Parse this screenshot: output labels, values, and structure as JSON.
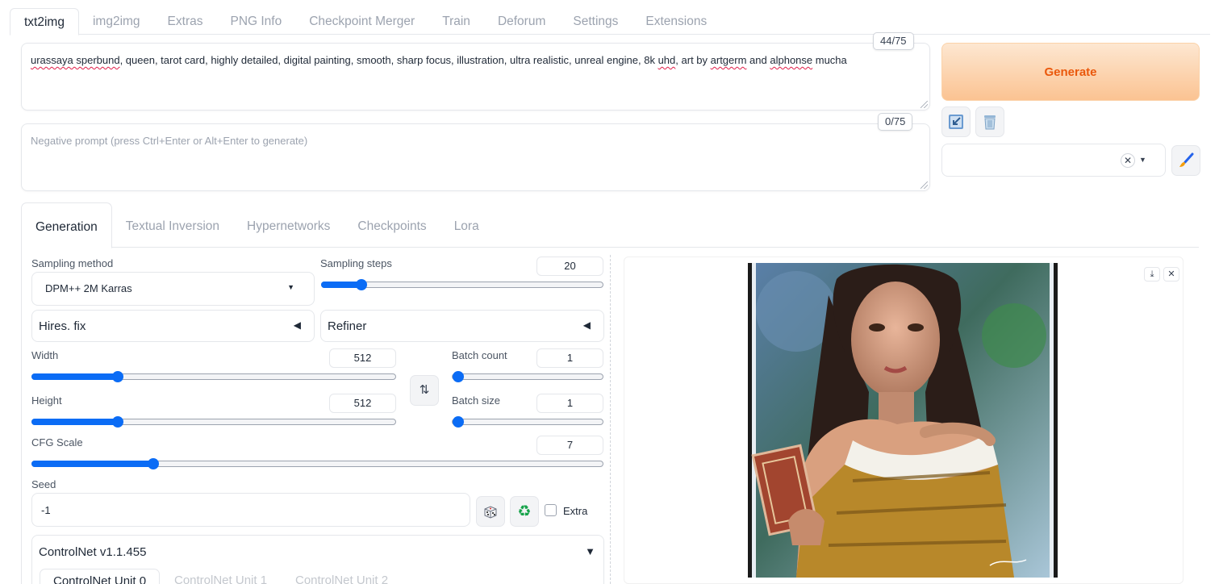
{
  "top_tabs": [
    "txt2img",
    "img2img",
    "Extras",
    "PNG Info",
    "Checkpoint Merger",
    "Train",
    "Deforum",
    "Settings",
    "Extensions"
  ],
  "prompt": {
    "words": [
      {
        "t": "urassaya sperbund",
        "err": true
      },
      {
        "t": ", queen, tarot card, highly detailed, digital painting, smooth, sharp focus, illustration, ultra realistic, unreal engine, 8k ",
        "err": false
      },
      {
        "t": "uhd",
        "err": true
      },
      {
        "t": ", art by ",
        "err": false
      },
      {
        "t": "artgerm",
        "err": true
      },
      {
        "t": " and ",
        "err": false
      },
      {
        "t": "alphonse",
        "err": true
      },
      {
        "t": " mucha",
        "err": false
      }
    ],
    "token_count": "44/75"
  },
  "negative_prompt": {
    "placeholder": "Negative prompt (press Ctrl+Enter or Alt+Enter to generate)",
    "token_count": "0/75"
  },
  "generate_label": "Generate",
  "icons": {
    "paste": "arrow-paste-icon",
    "trash": "trash-icon",
    "clear": "clear-x-icon",
    "brush": "paint-brush-icon",
    "dice": "dice-icon",
    "recycle": "recycle-icon",
    "swap": "swap-icon"
  },
  "sub_tabs": [
    "Generation",
    "Textual Inversion",
    "Hypernetworks",
    "Checkpoints",
    "Lora"
  ],
  "sampling": {
    "method_label": "Sampling method",
    "method_value": "DPM++ 2M Karras",
    "steps_label": "Sampling steps",
    "steps_value": "20"
  },
  "hires_label": "Hires. fix",
  "refiner_label": "Refiner",
  "width": {
    "label": "Width",
    "value": "512"
  },
  "height": {
    "label": "Height",
    "value": "512"
  },
  "batch_count": {
    "label": "Batch count",
    "value": "1"
  },
  "batch_size": {
    "label": "Batch size",
    "value": "1"
  },
  "cfg": {
    "label": "CFG Scale",
    "value": "7"
  },
  "seed": {
    "label": "Seed",
    "value": "-1",
    "extra_label": "Extra"
  },
  "controlnet": {
    "title": "ControlNet v1.1.455",
    "tabs": [
      "ControlNet Unit 0",
      "ControlNet Unit 1",
      "ControlNet Unit 2"
    ]
  },
  "colors": {
    "accent": "#0b6cf5",
    "generate_text": "#ea580c"
  }
}
